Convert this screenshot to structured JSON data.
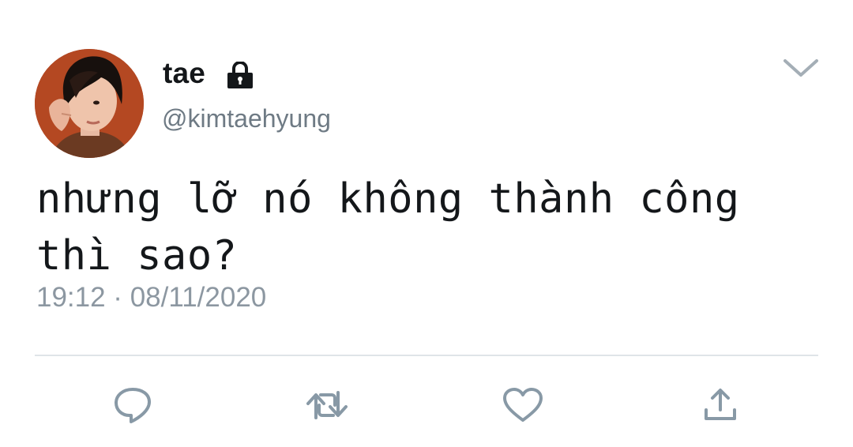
{
  "tweet": {
    "display_name": "tae",
    "handle": "@kimtaehyung",
    "text_line1": "nhưng lỡ nó không thành công",
    "text_line2": "thì sao?",
    "timestamp": "19:12 · 08/11/2020"
  },
  "icons": {
    "lock": "lock-icon",
    "menu": "chevron-down-icon",
    "reply": "reply-icon",
    "retweet": "retweet-icon",
    "like": "heart-icon",
    "share": "share-icon"
  },
  "colors": {
    "text": "#14171a",
    "secondary": "#6e7a84",
    "timestamp": "#8c97a1",
    "divider": "#dfe4e8",
    "icon": "#8899a6",
    "avatar_background": "#b5431f"
  }
}
